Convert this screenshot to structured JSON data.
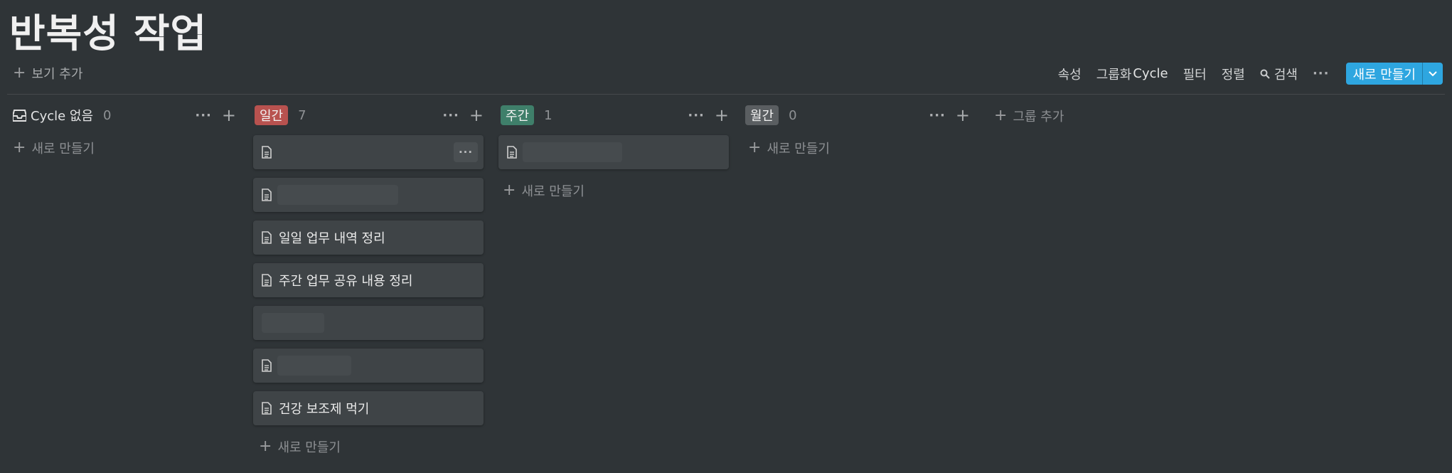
{
  "page": {
    "title": "반복성 작업"
  },
  "toolbar": {
    "add_view": "보기 추가",
    "properties": "속성",
    "group_prefix": "그룹화",
    "group_value": "Cycle",
    "filter": "필터",
    "sort": "정렬",
    "search": "검색",
    "more": "···",
    "new": "새로 만들기"
  },
  "board": {
    "no_cycle": {
      "label": "Cycle 없음",
      "count": "0",
      "new_label": "새로 만들기"
    },
    "daily": {
      "label": "일간",
      "color": "#b8524f",
      "count": "7",
      "cards": [
        {
          "title": "",
          "icon": "document-icon"
        },
        {
          "title": "",
          "icon": "document-icon"
        },
        {
          "title": "일일 업무 내역 정리",
          "icon": "document-icon"
        },
        {
          "title": "주간 업무 공유 내용 정리",
          "icon": "document-icon"
        },
        {
          "title": "",
          "icon": ""
        },
        {
          "title": "",
          "icon": "document-icon"
        },
        {
          "title": "건강 보조제 먹기",
          "icon": "document-icon"
        }
      ],
      "new_label": "새로 만들기"
    },
    "weekly": {
      "label": "주간",
      "color": "#3f7f6a",
      "count": "1",
      "cards": [
        {
          "title": "",
          "icon": "document-icon"
        }
      ],
      "new_label": "새로 만들기"
    },
    "monthly": {
      "label": "월간",
      "color": "#5a5e61",
      "count": "0",
      "new_label": "새로 만들기"
    },
    "add_group": "그룹 추가"
  },
  "colors": {
    "background": "#2f3437",
    "accent": "#2ea6e0",
    "card": "#3f4447"
  }
}
